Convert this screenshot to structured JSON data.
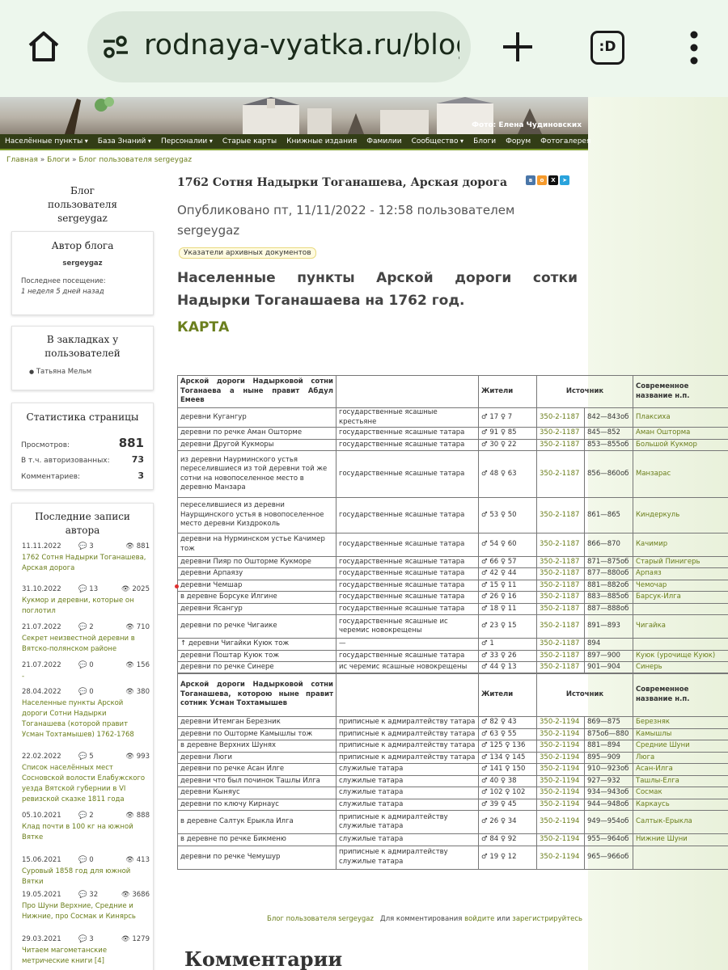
{
  "browser": {
    "url": "rodnaya-vyatka.ru/blog",
    "tabs_icon": ":D"
  },
  "banner": {
    "photo_credit": "Фото: Елена Чудиновских"
  },
  "nav": [
    {
      "label": "Населённые пункты",
      "dd": true
    },
    {
      "label": "База Знаний",
      "dd": true
    },
    {
      "label": "Персоналии",
      "dd": true
    },
    {
      "label": "Старые карты",
      "dd": false
    },
    {
      "label": "Книжные издания",
      "dd": false
    },
    {
      "label": "Фамилии",
      "dd": false
    },
    {
      "label": "Сообщество",
      "dd": true
    },
    {
      "label": "Блоги",
      "dd": false
    },
    {
      "label": "Форум",
      "dd": false
    },
    {
      "label": "Фотогалерея",
      "dd": false
    }
  ],
  "breadcrumb": {
    "home": "Главная",
    "sep": " » ",
    "blogs": "Блоги",
    "user": "Блог пользователя sergeygaz"
  },
  "sidebar": {
    "blog_title": "Блог пользователя sergeygaz",
    "author": {
      "title": "Автор блога",
      "name": "sergeygaz",
      "last_label": "Последнее посещение:",
      "last_value": "1 неделя 5 дней назад"
    },
    "bookmarks": {
      "title": "В закладках у пользователей",
      "user": "Татьяна Мельм"
    },
    "stats": {
      "title": "Статистика страницы",
      "views_label": "Просмотров:",
      "views": "881",
      "auth_label": "В т.ч. авторизованных:",
      "auth": "73",
      "comments_label": "Комментариев:",
      "comments": "3"
    },
    "recent": {
      "title": "Последние записи автора",
      "items": [
        {
          "date": "11.11.2022",
          "c": "3",
          "v": "881",
          "title": "1762 Сотня Надырки Тоганашева, Арская дорога"
        },
        {
          "date": "31.10.2022",
          "c": "13",
          "v": "2025",
          "title": "Кукмор и деревни, которые он поглотил"
        },
        {
          "date": "21.07.2022",
          "c": "2",
          "v": "710",
          "title": "Секрет неизвестной деревни в Вятско-полянском районе"
        },
        {
          "date": "21.07.2022",
          "c": "0",
          "v": "156",
          "title": "-"
        },
        {
          "date": "28.04.2022",
          "c": "0",
          "v": "380",
          "title": "Населенные пункты Арской дороги Сотни Надырки Тоганашева (которой правит Усман Тохтамышев) 1762-1768"
        },
        {
          "date": "22.02.2022",
          "c": "5",
          "v": "993",
          "title": "Список населённых мест Сосновской волости Елабужского уезда Вятской губернии в VI ревизской сказке 1811 года"
        },
        {
          "date": "05.10.2021",
          "c": "2",
          "v": "888",
          "title": "Клад почти в 100 кг на южной Вятке"
        },
        {
          "date": "15.06.2021",
          "c": "0",
          "v": "413",
          "title": "Суровый 1858 год для южной Вятки"
        },
        {
          "date": "19.05.2021",
          "c": "32",
          "v": "3686",
          "title": "Про Шуни Верхние, Средние и Нижние, про Сосмак и Кинярсь"
        },
        {
          "date": "29.03.2021",
          "c": "3",
          "v": "1279",
          "title": "Читаем магометанские метрические книги [4]"
        }
      ]
    }
  },
  "article": {
    "title": "1762 Сотня Надырки Тоганашева, Арская дорога",
    "published": "Опубликовано пт, 11/11/2022 - 12:58 пользователем sergeygaz",
    "tag": "Указатели архивных документов",
    "heading": "Населенные пункты Арской дороги сотки Надырки Тоганашаева на 1762 год.",
    "map": "КАРТА"
  },
  "table1": {
    "header": {
      "c1": "Арской дороги Надырковой сотни Тоганаева а ныне правит Абдул Емеев",
      "c2": "",
      "c3": "Жители",
      "c4": "Источник",
      "c6": "Современное название н.п."
    },
    "rows": [
      {
        "n": "деревни Кугангур",
        "s": "государственные ясашные крестьяне",
        "p": "♂ 17 ♀ 7",
        "a": "350-2-1187",
        "l": "842—843об",
        "m": "Плаксиха"
      },
      {
        "n": "деревни по речке Аман Ошторме",
        "s": "государственные ясашные татара",
        "p": "♂ 91 ♀ 85",
        "a": "350-2-1187",
        "l": "845—852",
        "m": "Аман Ошторма"
      },
      {
        "n": "деревни Другой Кукморы",
        "s": "государственные ясашные татара",
        "p": "♂ 30 ♀ 22",
        "a": "350-2-1187",
        "l": "853—855об",
        "m": "Большой Кукмор"
      },
      {
        "n": "из деревни Наурминского устья переселившиеся из той деревни той же сотни на новопоселенное место в деревню Манзара",
        "s": "государственные ясашные татара",
        "p": "♂ 48 ♀ 63",
        "a": "350-2-1187",
        "l": "856—860об",
        "m": "Манзарас"
      },
      {
        "n": "переселившиеся из деревни Наурщинского устья в новопоселенное место деревни Киздроколь",
        "s": "государственные ясашные татара",
        "p": "♂ 53 ♀ 50",
        "a": "350-2-1187",
        "l": "861—865",
        "m": "Киндеркуль"
      },
      {
        "n": "деревни на Нурминском устье Качимер тож",
        "s": "государственные ясашные татара",
        "p": "♂ 54 ♀ 60",
        "a": "350-2-1187",
        "l": "866—870",
        "m": "Качимир"
      },
      {
        "n": "деревни Пияр по Ошторме Кукморе",
        "s": "государственные ясашные татара",
        "p": "♂ 66 ♀ 57",
        "a": "350-2-1187",
        "l": "871—875об",
        "m": "Старый Пинигерь"
      },
      {
        "n": "деревни Арпаязу",
        "s": "государственные ясашные татара",
        "p": "♂ 42 ♀ 44",
        "a": "350-2-1187",
        "l": "877—880об",
        "m": "Арпаяз"
      },
      {
        "n": "деревни Чемшар",
        "s": "государственные ясашные татара",
        "p": "♂ 15 ♀ 11",
        "a": "350-2-1187",
        "l": "881—882об",
        "m": "Чемочар"
      },
      {
        "n": "в деревне Борсуке Илгине",
        "s": "государственные ясашные татара",
        "p": "♂ 26 ♀ 16",
        "a": "350-2-1187",
        "l": "883—885об",
        "m": "Барсук-Илга"
      },
      {
        "n": "деревни Ясангур",
        "s": "государственные ясашные татара",
        "p": "♂ 18 ♀ 11",
        "a": "350-2-1187",
        "l": "887—888об",
        "m": ""
      },
      {
        "n": "деревни по речке Чигаике",
        "s": "государственные ясашные ис черемис новокрещены",
        "p": "♂ 23 ♀ 15",
        "a": "350-2-1187",
        "l": "891—893",
        "m": "Чигайка"
      },
      {
        "n": "↑ деревни Чигайки Куюк тож",
        "s": "—",
        "p": "♂ 1",
        "a": "350-2-1187",
        "l": "894",
        "m": ""
      },
      {
        "n": "деревни Поштар Куюк тож",
        "s": "государственные ясашные татара",
        "p": "♂ 33 ♀ 26",
        "a": "350-2-1187",
        "l": "897—900",
        "m": "Куюк (урочище Куюк)"
      },
      {
        "n": "деревни по речке Синере",
        "s": "ис черемис ясашные новокрещены",
        "p": "♂ 44 ♀ 13",
        "a": "350-2-1187",
        "l": "901—904",
        "m": "Синерь"
      }
    ]
  },
  "table2": {
    "header": {
      "c1": "Арской дороги Надырковой сотни Тоганашева, которою ныне правит сотник Усман Тохтамышев",
      "c2": "",
      "c3": "Жители",
      "c4": "Источник",
      "c6": "Современное название н.п."
    },
    "rows": [
      {
        "n": "деревни Итемган Березник",
        "s": "приписные к адмиралтейству татара",
        "p": "♂ 82 ♀ 43",
        "a": "350-2-1194",
        "l": "869—875",
        "m": "Березняк"
      },
      {
        "n": "деревни по Ошторме Камышлы тож",
        "s": "приписные к адмиралтейству татара",
        "p": "♂ 63 ♀ 55",
        "a": "350-2-1194",
        "l": "875об—880",
        "m": "Камышлы"
      },
      {
        "n": "в деревне Верхних Шунях",
        "s": "приписные к адмиралтейству татара",
        "p": "♂ 125 ♀ 136",
        "a": "350-2-1194",
        "l": "881—894",
        "m": "Средние Шуни"
      },
      {
        "n": "деревни Люги",
        "s": "приписные к адмиралтейству татара",
        "p": "♂ 134 ♀ 145",
        "a": "350-2-1194",
        "l": "895—909",
        "m": "Люга"
      },
      {
        "n": "деревни по речке Асан Илге",
        "s": "служилые татара",
        "p": "♂ 141 ♀ 150",
        "a": "350-2-1194",
        "l": "910—923об",
        "m": "Асан-Илга"
      },
      {
        "n": "деревни что был починок Ташлы Илга",
        "s": "служилые татара",
        "p": "♂ 40 ♀ 38",
        "a": "350-2-1194",
        "l": "927—932",
        "m": "Ташлы-Елга"
      },
      {
        "n": "деревни Кыняус",
        "s": "служилые татара",
        "p": "♂ 102 ♀ 102",
        "a": "350-2-1194",
        "l": "934—943об",
        "m": "Сосмак"
      },
      {
        "n": "деревни по ключу Кирнаус",
        "s": "служилые татара",
        "p": "♂ 39 ♀ 45",
        "a": "350-2-1194",
        "l": "944—948об",
        "m": "Каркаусь"
      },
      {
        "n": "в деревне Салтук Ерыкла Илга",
        "s": "приписные к адмиралтейству служилые татара",
        "p": "♂ 26 ♀ 34",
        "a": "350-2-1194",
        "l": "949—954об",
        "m": "Салтык-Ерыкла"
      },
      {
        "n": "в деревне по речке Бикменю",
        "s": "служилые татара",
        "p": "♂ 84 ♀ 92",
        "a": "350-2-1194",
        "l": "955—964об",
        "m": "Нижние Шуни"
      },
      {
        "n": "деревни по речке Чемушур",
        "s": "приписные к адмиралтейству служилые татара",
        "p": "♂ 19 ♀ 12",
        "a": "350-2-1194",
        "l": "965—966об",
        "m": ""
      }
    ]
  },
  "footer": {
    "blog": "Блог пользователя sergeygaz",
    "t1": "Для комментирования ",
    "login": "войдите",
    "t2": " или ",
    "reg": "зарегистрируйтесь"
  },
  "comments_title": "Комментарии"
}
